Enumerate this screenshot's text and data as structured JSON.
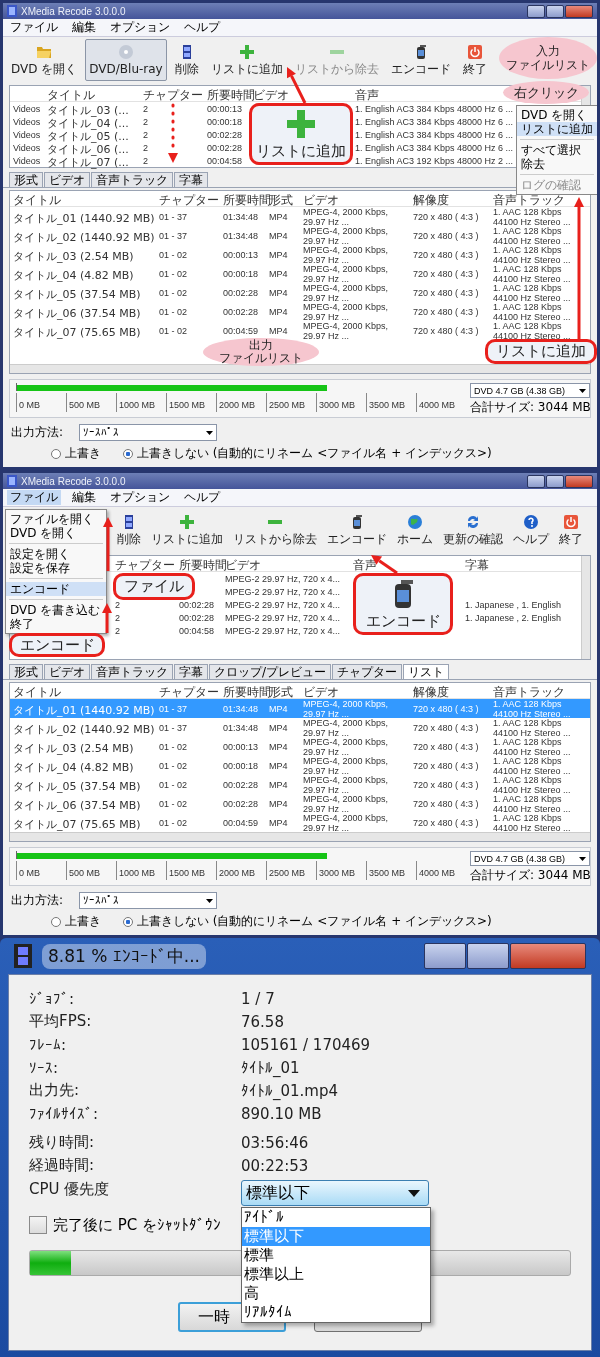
{
  "panels": [
    {
      "window": {
        "title": "XMedia Recode 3.0.0.0"
      },
      "menu": [
        {
          "label": "ファイル",
          "selected": false
        },
        {
          "label": "編集",
          "selected": false
        },
        {
          "label": "オプション",
          "selected": false
        },
        {
          "label": "ヘルプ",
          "selected": false
        }
      ],
      "toolbar": [
        {
          "label": "DVD を開く",
          "kind": "open",
          "selected": false,
          "disabled": false
        },
        {
          "label": "DVD/Blu-ray",
          "kind": "disc",
          "selected": true,
          "disabled": false
        },
        {
          "label": "削除",
          "kind": "film",
          "selected": false,
          "disabled": false
        },
        {
          "label": "リストに追加",
          "kind": "plus",
          "selected": false,
          "disabled": false
        },
        {
          "label": "リストから除去",
          "kind": "minus",
          "selected": false,
          "disabled": true
        },
        {
          "label": "エンコード",
          "kind": "encode",
          "selected": false,
          "disabled": false
        },
        {
          "label": "終了",
          "kind": "exit",
          "selected": false,
          "disabled": false
        }
      ],
      "input_list": {
        "columns": {
          "title": "タイトル",
          "chapters": "チャプター",
          "duration": "所要時間",
          "video": "ビデオ",
          "audio": "音声"
        },
        "rows": [
          {
            "source": "Videos",
            "title": "タイトル_03 (...",
            "chapters": "2",
            "duration": "00:00:13",
            "audio": "1. English AC3 384 Kbps 48000 Hz 6 ..."
          },
          {
            "source": "Videos",
            "title": "タイトル_04 (...",
            "chapters": "2",
            "duration": "00:00:18",
            "audio": "1. English AC3 384 Kbps 48000 Hz 6 ..."
          },
          {
            "source": "Videos",
            "title": "タイトル_05 (...",
            "chapters": "2",
            "duration": "00:02:28",
            "audio": "1. English AC3 384 Kbps 48000 Hz 6 ..."
          },
          {
            "source": "Videos",
            "title": "タイトル_06 (...",
            "chapters": "2",
            "duration": "00:02:28",
            "audio": "1. English AC3 384 Kbps 48000 Hz 6 ..."
          },
          {
            "source": "Videos",
            "title": "タイトル_07 (...",
            "chapters": "2",
            "duration": "00:04:58",
            "audio": "1. English AC3 192 Kbps 48000 Hz 2 ..."
          }
        ]
      },
      "tabs": [
        {
          "label": "形式",
          "selected": false
        },
        {
          "label": "ビデオ",
          "selected": false
        },
        {
          "label": "音声トラック",
          "selected": false
        },
        {
          "label": "字幕",
          "selected": false
        }
      ],
      "output_list": {
        "columns": {
          "title": "タイトル",
          "chapters": "チャプター",
          "duration": "所要時間",
          "format": "形式",
          "video": "ビデオ",
          "resolution": "解像度",
          "audio": "音声トラック"
        },
        "rows": [
          {
            "selected": false,
            "title": "タイトル_01 (1440.92 MB)",
            "chapters": "01 - 37",
            "duration": "01:34:48",
            "format": "MP4",
            "video": "MPEG-4, 2000 Kbps, 29.97 Hz ...",
            "resolution": "720 x 480 ( 4:3 )",
            "audio": "1. AAC 128 Kbps 44100 Hz Stereo ..."
          },
          {
            "selected": false,
            "title": "タイトル_02 (1440.92 MB)",
            "chapters": "01 - 37",
            "duration": "01:34:48",
            "format": "MP4",
            "video": "MPEG-4, 2000 Kbps, 29.97 Hz ...",
            "resolution": "720 x 480 ( 4:3 )",
            "audio": "1. AAC 128 Kbps 44100 Hz Stereo ..."
          },
          {
            "selected": false,
            "title": "タイトル_03 (2.54 MB)",
            "chapters": "01 - 02",
            "duration": "00:00:13",
            "format": "MP4",
            "video": "MPEG-4, 2000 Kbps, 29.97 Hz ...",
            "resolution": "720 x 480 ( 4:3 )",
            "audio": "1. AAC 128 Kbps 44100 Hz Stereo ..."
          },
          {
            "selected": false,
            "title": "タイトル_04 (4.82 MB)",
            "chapters": "01 - 02",
            "duration": "00:00:18",
            "format": "MP4",
            "video": "MPEG-4, 2000 Kbps, 29.97 Hz ...",
            "resolution": "720 x 480 ( 4:3 )",
            "audio": "1. AAC 128 Kbps 44100 Hz Stereo ..."
          },
          {
            "selected": false,
            "title": "タイトル_05 (37.54 MB)",
            "chapters": "01 - 02",
            "duration": "00:02:28",
            "format": "MP4",
            "video": "MPEG-4, 2000 Kbps, 29.97 Hz ...",
            "resolution": "720 x 480 ( 4:3 )",
            "audio": "1. AAC 128 Kbps 44100 Hz Stereo ..."
          },
          {
            "selected": false,
            "title": "タイトル_06 (37.54 MB)",
            "chapters": "01 - 02",
            "duration": "00:02:28",
            "format": "MP4",
            "video": "MPEG-4, 2000 Kbps, 29.97 Hz ...",
            "resolution": "720 x 480 ( 4:3 )",
            "audio": "1. AAC 128 Kbps 44100 Hz Stereo ..."
          },
          {
            "selected": false,
            "title": "タイトル_07 (75.65 MB)",
            "chapters": "01 - 02",
            "duration": "00:04:59",
            "format": "MP4",
            "video": "MPEG-4, 2000 Kbps, 29.97 Hz ...",
            "resolution": "720 x 480 ( 4:3 )",
            "audio": "1. AAC 128 Kbps 44100 Hz Stereo ..."
          }
        ]
      },
      "size_bar": {
        "level": 0.69,
        "ticks": [
          "0 MB",
          "500 MB",
          "1000 MB",
          "1500 MB",
          "2000 MB",
          "2500 MB",
          "3000 MB",
          "3500 MB",
          "4000 MB"
        ],
        "target": "DVD 4.7 GB (4.38 GB)",
        "total": "合計サイズ: 3044 MB"
      },
      "output_method": {
        "label": "出力方法:",
        "value": "ｿｰｽﾊﾟｽ",
        "options": [
          {
            "label": "上書き",
            "selected": false
          },
          {
            "label": "上書きしない (自動的にリネーム <ファイル名 + インデックス>)",
            "selected": true
          }
        ]
      },
      "context_menu": {
        "groups": [
          [
            {
              "label": "DVD を開く",
              "selected": false,
              "disabled": false
            },
            {
              "label": "リストに追加",
              "selected": true,
              "disabled": false
            }
          ],
          [
            {
              "label": "すべて選択",
              "selected": false,
              "disabled": false
            },
            {
              "label": "除去",
              "selected": false,
              "disabled": false
            }
          ],
          [
            {
              "label": "ログの確認",
              "selected": false,
              "disabled": true
            }
          ]
        ]
      },
      "callouts": [
        {
          "kind": "cloud",
          "lines": [
            "入力",
            "ファイルリスト"
          ]
        },
        {
          "kind": "cloud",
          "lines": [
            "右クリック"
          ]
        },
        {
          "kind": "add-box",
          "lines": [
            "リストに追加"
          ]
        },
        {
          "kind": "box",
          "lines": [
            "リストに追加"
          ]
        },
        {
          "kind": "cloud",
          "lines": [
            "出力",
            "ファイルリスト"
          ]
        }
      ]
    },
    {
      "window": {
        "title": "XMedia Recode 3.0.0.0"
      },
      "menu": [
        {
          "label": "ファイル",
          "selected": true
        },
        {
          "label": "編集",
          "selected": false
        },
        {
          "label": "オプション",
          "selected": false
        },
        {
          "label": "ヘルプ",
          "selected": false
        }
      ],
      "toolbar": [
        {
          "label": "削除",
          "kind": "film",
          "selected": false,
          "disabled": false
        },
        {
          "label": "リストに追加",
          "kind": "plus",
          "selected": false,
          "disabled": false
        },
        {
          "label": "リストから除去",
          "kind": "minus",
          "selected": false,
          "disabled": false
        },
        {
          "label": "エンコード",
          "kind": "encode",
          "selected": false,
          "disabled": false
        },
        {
          "label": "ホーム",
          "kind": "globe",
          "selected": false,
          "disabled": false
        },
        {
          "label": "更新の確認",
          "kind": "refresh",
          "selected": false,
          "disabled": false
        },
        {
          "label": "ヘルプ",
          "kind": "help",
          "selected": false,
          "disabled": false
        },
        {
          "label": "終了",
          "kind": "exit",
          "selected": false,
          "disabled": false
        }
      ],
      "input_list": {
        "columns": {
          "chapters": "チャプター",
          "duration": "所要時間",
          "video": "ビデオ",
          "audio": "音声",
          "subtitles": "字幕"
        },
        "rows": [
          {
            "video": "MPEG-2 29.97 Hz, 720 x 4..."
          },
          {
            "video": "MPEG-2 29.97 Hz, 720 x 4..."
          },
          {
            "chapters": "2",
            "duration": "00:02:28",
            "video": "MPEG-2 29.97 Hz, 720 x 4...",
            "subtitles": "1. Japanese , 1. English"
          },
          {
            "chapters": "2",
            "duration": "00:02:28",
            "video": "MPEG-2 29.97 Hz, 720 x 4...",
            "subtitles": "1. Japanese , 2. English"
          },
          {
            "chapters": "2",
            "duration": "00:04:58",
            "video": "MPEG-2 29.97 Hz, 720 x 4..."
          }
        ]
      },
      "tabs": [
        {
          "label": "形式",
          "selected": false
        },
        {
          "label": "ビデオ",
          "selected": false
        },
        {
          "label": "音声トラック",
          "selected": false
        },
        {
          "label": "字幕",
          "selected": false
        },
        {
          "label": "クロップ/プレビュー",
          "selected": false
        },
        {
          "label": "チャプター",
          "selected": false
        },
        {
          "label": "リスト",
          "selected": true
        }
      ],
      "output_list": {
        "columns": {
          "title": "タイトル",
          "chapters": "チャプター",
          "duration": "所要時間",
          "format": "形式",
          "video": "ビデオ",
          "resolution": "解像度",
          "audio": "音声トラック"
        },
        "rows": [
          {
            "selected": true,
            "title": "タイトル_01 (1440.92 MB)",
            "chapters": "01 - 37",
            "duration": "01:34:48",
            "format": "MP4",
            "video": "MPEG-4, 2000 Kbps, 29.97 Hz ...",
            "resolution": "720 x 480 ( 4:3 )",
            "audio": "1. AAC 128 Kbps 44100 Hz Stereo ..."
          },
          {
            "selected": false,
            "title": "タイトル_02 (1440.92 MB)",
            "chapters": "01 - 37",
            "duration": "01:34:48",
            "format": "MP4",
            "video": "MPEG-4, 2000 Kbps, 29.97 Hz ...",
            "resolution": "720 x 480 ( 4:3 )",
            "audio": "1. AAC 128 Kbps 44100 Hz Stereo ..."
          },
          {
            "selected": false,
            "title": "タイトル_03 (2.54 MB)",
            "chapters": "01 - 02",
            "duration": "00:00:13",
            "format": "MP4",
            "video": "MPEG-4, 2000 Kbps, 29.97 Hz ...",
            "resolution": "720 x 480 ( 4:3 )",
            "audio": "1. AAC 128 Kbps 44100 Hz Stereo ..."
          },
          {
            "selected": false,
            "title": "タイトル_04 (4.82 MB)",
            "chapters": "01 - 02",
            "duration": "00:00:18",
            "format": "MP4",
            "video": "MPEG-4, 2000 Kbps, 29.97 Hz ...",
            "resolution": "720 x 480 ( 4:3 )",
            "audio": "1. AAC 128 Kbps 44100 Hz Stereo ..."
          },
          {
            "selected": false,
            "title": "タイトル_05 (37.54 MB)",
            "chapters": "01 - 02",
            "duration": "00:02:28",
            "format": "MP4",
            "video": "MPEG-4, 2000 Kbps, 29.97 Hz ...",
            "resolution": "720 x 480 ( 4:3 )",
            "audio": "1. AAC 128 Kbps 44100 Hz Stereo ..."
          },
          {
            "selected": false,
            "title": "タイトル_06 (37.54 MB)",
            "chapters": "01 - 02",
            "duration": "00:02:28",
            "format": "MP4",
            "video": "MPEG-4, 2000 Kbps, 29.97 Hz ...",
            "resolution": "720 x 480 ( 4:3 )",
            "audio": "1. AAC 128 Kbps 44100 Hz Stereo ..."
          },
          {
            "selected": false,
            "title": "タイトル_07 (75.65 MB)",
            "chapters": "01 - 02",
            "duration": "00:04:59",
            "format": "MP4",
            "video": "MPEG-4, 2000 Kbps, 29.97 Hz ...",
            "resolution": "720 x 480 ( 4:3 )",
            "audio": "1. AAC 128 Kbps 44100 Hz Stereo ..."
          }
        ]
      },
      "size_bar": {
        "level": 0.69,
        "ticks": [
          "0 MB",
          "500 MB",
          "1000 MB",
          "1500 MB",
          "2000 MB",
          "2500 MB",
          "3000 MB",
          "3500 MB",
          "4000 MB"
        ],
        "target": "DVD 4.7 GB (4.38 GB)",
        "total": "合計サイズ: 3044 MB"
      },
      "output_method": {
        "label": "出力方法:",
        "value": "ｿｰｽﾊﾟｽ",
        "options": [
          {
            "label": "上書き",
            "selected": false
          },
          {
            "label": "上書きしない (自動的にリネーム <ファイル名 + インデックス>)",
            "selected": true
          }
        ]
      },
      "file_menu": {
        "groups": [
          [
            {
              "label": "ファイルを開く",
              "selected": false
            },
            {
              "label": "DVD を開く",
              "selected": false
            }
          ],
          [
            {
              "label": "設定を開く",
              "selected": false
            },
            {
              "label": "設定を保存",
              "selected": false
            }
          ],
          [
            {
              "label": "エンコード",
              "selected": true
            }
          ],
          [
            {
              "label": "DVD を書き込む",
              "selected": false
            },
            {
              "label": "終了",
              "selected": false
            }
          ]
        ]
      },
      "callouts": [
        {
          "kind": "box",
          "lines": [
            "ファイル"
          ]
        },
        {
          "kind": "encode-box",
          "lines": [
            "エンコード"
          ]
        },
        {
          "kind": "box",
          "lines": [
            "エンコード"
          ]
        }
      ]
    }
  ],
  "dialog": {
    "title": "8.81 % ｴﾝｺｰﾄﾞ中...",
    "fields": [
      {
        "label": "ｼﾞｮﾌﾞ:",
        "value": "1 / 7"
      },
      {
        "label": "平均FPS:",
        "value": "76.58"
      },
      {
        "label": "ﾌﾚｰﾑ:",
        "value": "105161 / 170469"
      },
      {
        "label": "ｿｰｽ:",
        "value": "ﾀｲﾄﾙ_01"
      },
      {
        "label": "出力先:",
        "value": "ﾀｲﾄﾙ_01.mp4"
      },
      {
        "label": "ﾌｧｲﾙｻｲｽﾞ:",
        "value": "890.10 MB"
      }
    ],
    "times": [
      {
        "label": "残り時間:",
        "value": "03:56:46"
      },
      {
        "label": "経過時間:",
        "value": "00:22:53"
      }
    ],
    "priority": {
      "label": "CPU 優先度",
      "value": "標準以下",
      "options": [
        {
          "label": "ｱｲﾄﾞﾙ",
          "selected": false
        },
        {
          "label": "標準以下",
          "selected": true
        },
        {
          "label": "標準",
          "selected": false
        },
        {
          "label": "標準以上",
          "selected": false
        },
        {
          "label": "高",
          "selected": false
        },
        {
          "label": "ﾘｱﾙﾀｲﾑ",
          "selected": false
        }
      ]
    },
    "shutdown": {
      "label": "完了後に PC をｼｬｯﾄﾀﾞｳﾝ",
      "checked": false
    },
    "progress": {
      "level": 0.075
    },
    "buttons": [
      {
        "label": "一時",
        "focused": true
      },
      {
        "focused": false
      }
    ]
  }
}
